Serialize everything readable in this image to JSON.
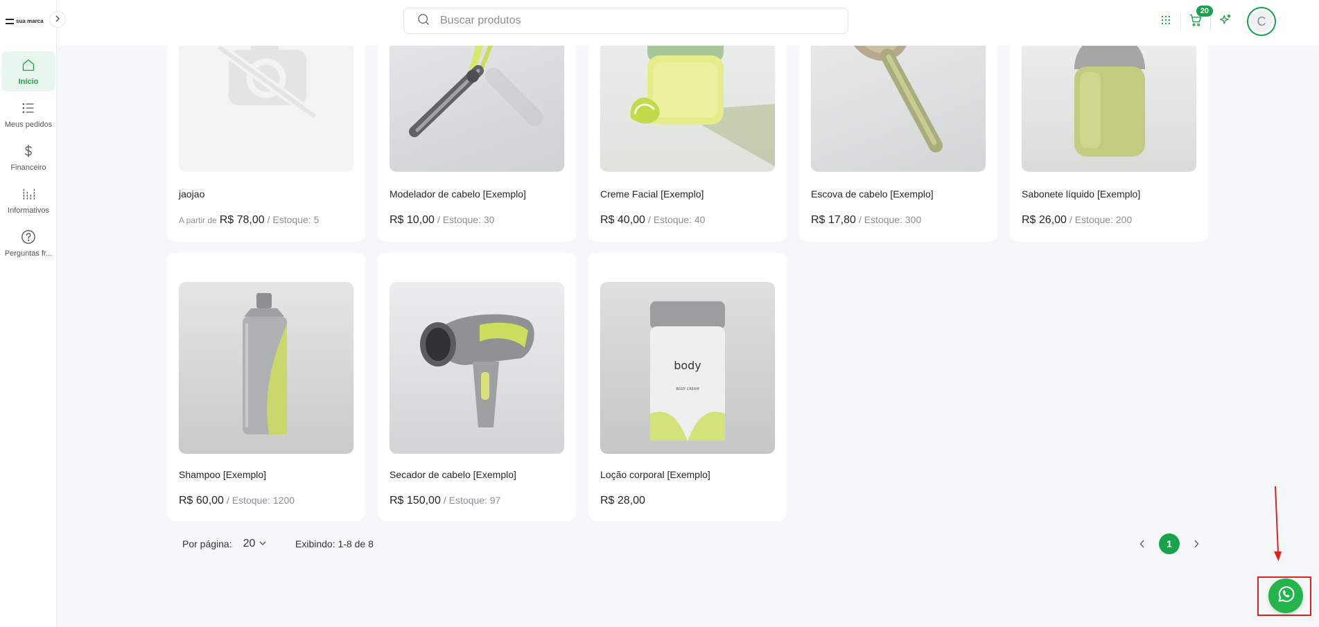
{
  "brand": {
    "logo_text": "sua marca"
  },
  "sidebar": {
    "items": [
      {
        "label": "Início",
        "icon": "home-icon",
        "active": true
      },
      {
        "label": "Meus pedidos",
        "icon": "list-icon",
        "active": false
      },
      {
        "label": "Financeiro",
        "icon": "dollar-icon",
        "active": false
      },
      {
        "label": "Informativos",
        "icon": "equalizer-icon",
        "active": false
      },
      {
        "label": "Perguntas fr...",
        "icon": "help-icon",
        "active": false
      }
    ]
  },
  "header": {
    "search_placeholder": "Buscar produtos",
    "cart_count": "20",
    "avatar_initial": "C"
  },
  "products": [
    {
      "name": "jaojao",
      "from_label": "A partir de",
      "price": "R$ 78,00",
      "stock": "/ Estoque: 5",
      "image": "no-image-placeholder"
    },
    {
      "name": "Modelador de cabelo [Exemplo]",
      "price": "R$ 10,00",
      "stock": "/ Estoque: 30",
      "image": "curling-iron"
    },
    {
      "name": "Creme Facial [Exemplo]",
      "price": "R$ 40,00",
      "stock": "/ Estoque: 40",
      "image": "face-cream-jar"
    },
    {
      "name": "Escova de cabelo [Exemplo]",
      "price": "R$ 17,80",
      "stock": "/ Estoque: 300",
      "image": "hair-brush"
    },
    {
      "name": "Sabonete líquido [Exemplo]",
      "price": "R$ 26,00",
      "stock": "/ Estoque: 200",
      "image": "liquid-soap-bottle"
    },
    {
      "name": "Shampoo [Exemplo]",
      "price": "R$ 60,00",
      "stock": "/ Estoque: 1200",
      "image": "shampoo-bottle"
    },
    {
      "name": "Secador de cabelo [Exemplo]",
      "price": "R$ 150,00",
      "stock": "/ Estoque: 97",
      "image": "hair-dryer"
    },
    {
      "name": "Loção corporal [Exemplo]",
      "price": "R$ 28,00",
      "stock": "",
      "image": "body-lotion-jar",
      "jar_label": "body",
      "jar_sublabel": "BODY CREAM"
    }
  ],
  "pagination": {
    "per_page_label": "Por página:",
    "per_page_value": "20",
    "showing": "Exibindo: 1-8 de 8",
    "current_page": "1"
  },
  "colors": {
    "accent": "#16a34a",
    "whatsapp": "#23b44c",
    "annotation": "#e0201b"
  }
}
